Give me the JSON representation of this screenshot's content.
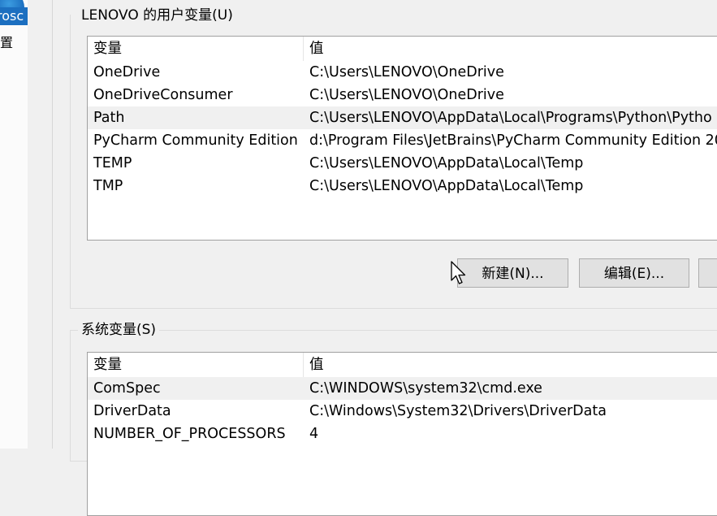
{
  "background_window": {
    "label_fragment": "rosc",
    "label_fragment2": "置"
  },
  "user_variables": {
    "title": "LENOVO 的用户变量(U)",
    "columns": [
      "变量",
      "值"
    ],
    "rows": [
      {
        "name": "OneDrive",
        "value": "C:\\Users\\LENOVO\\OneDrive"
      },
      {
        "name": "OneDriveConsumer",
        "value": "C:\\Users\\LENOVO\\OneDrive"
      },
      {
        "name": "Path",
        "value": "C:\\Users\\LENOVO\\AppData\\Local\\Programs\\Python\\Pytho"
      },
      {
        "name": "PyCharm Community Edition",
        "value": "d:\\Program Files\\JetBrains\\PyCharm Community Edition 20"
      },
      {
        "name": "TEMP",
        "value": "C:\\Users\\LENOVO\\AppData\\Local\\Temp"
      },
      {
        "name": "TMP",
        "value": "C:\\Users\\LENOVO\\AppData\\Local\\Temp"
      }
    ],
    "selected_row": 2,
    "buttons": {
      "new": "新建(N)...",
      "edit": "编辑(E)...",
      "delete": ""
    }
  },
  "system_variables": {
    "title": "系统变量(S)",
    "columns": [
      "变量",
      "值"
    ],
    "rows": [
      {
        "name": "ComSpec",
        "value": "C:\\WINDOWS\\system32\\cmd.exe"
      },
      {
        "name": "DriverData",
        "value": "C:\\Windows\\System32\\Drivers\\DriverData"
      },
      {
        "name": "NUMBER_OF_PROCESSORS",
        "value": "4"
      }
    ],
    "selected_row": 0
  },
  "colors": {
    "dialog_bg": "#f0f0f0",
    "list_bg": "#ffffff",
    "selected_row_bg": "#f0f0f0",
    "button_bg": "#e1e1e1",
    "accent_blue": "#1c6fc0"
  }
}
